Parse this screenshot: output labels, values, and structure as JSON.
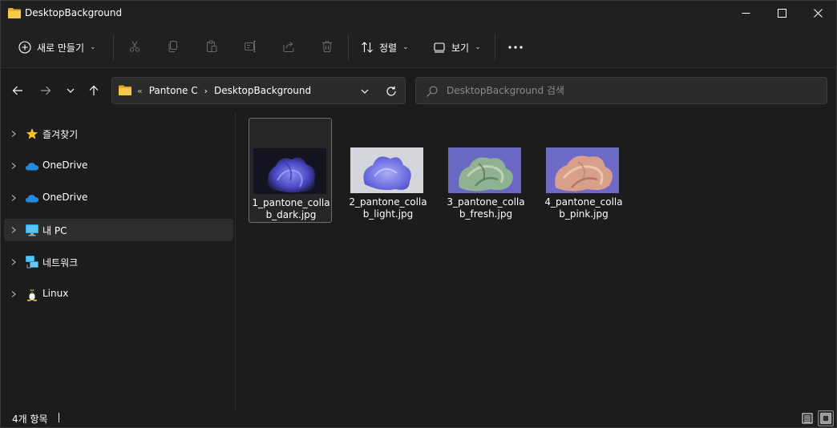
{
  "window": {
    "title": "DesktopBackground"
  },
  "toolbar": {
    "new_label": "새로 만들기",
    "sort_label": "정렬",
    "view_label": "보기",
    "icons": [
      "cut-icon",
      "copy-icon",
      "paste-icon",
      "rename-icon",
      "share-icon",
      "delete-icon"
    ]
  },
  "address": {
    "overflow": "«",
    "crumbs": [
      "Pantone C",
      "DesktopBackground"
    ],
    "separator": "›"
  },
  "search": {
    "placeholder": "DesktopBackground 검색"
  },
  "sidebar": {
    "items": [
      {
        "label": "즐겨찾기",
        "icon": "star-icon"
      },
      {
        "label": "OneDrive",
        "icon": "cloud-icon"
      },
      {
        "label": "OneDrive",
        "icon": "cloud-icon"
      },
      {
        "label": "내 PC",
        "icon": "pc-icon"
      },
      {
        "label": "네트워크",
        "icon": "network-icon"
      },
      {
        "label": "Linux",
        "icon": "linux-icon"
      }
    ],
    "selected_index": 3
  },
  "files": [
    {
      "name": "1_pantone_collab_dark.jpg",
      "selected": true
    },
    {
      "name": "2_pantone_collab_light.jpg",
      "selected": false
    },
    {
      "name": "3_pantone_collab_fresh.jpg",
      "selected": false
    },
    {
      "name": "4_pantone_collab_pink.jpg",
      "selected": false
    }
  ],
  "status": {
    "item_count": "4개 항목"
  },
  "colors": {
    "folder": "#f4c542",
    "accent": "#4cc2ff",
    "background": "#1c1c1c"
  }
}
